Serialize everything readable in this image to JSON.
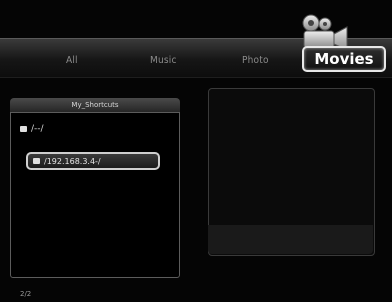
{
  "tabs": {
    "all": "All",
    "music": "Music",
    "photo": "Photo",
    "movies": "Movies"
  },
  "shortcuts": {
    "title": "My_Shortcuts",
    "items": [
      "/--/",
      "/192.168.3.4-/"
    ],
    "selected_index": 1
  },
  "icons": {
    "movies": "movie-camera-icon",
    "folder": "folder-icon"
  },
  "footer": {
    "page": "2/2"
  }
}
